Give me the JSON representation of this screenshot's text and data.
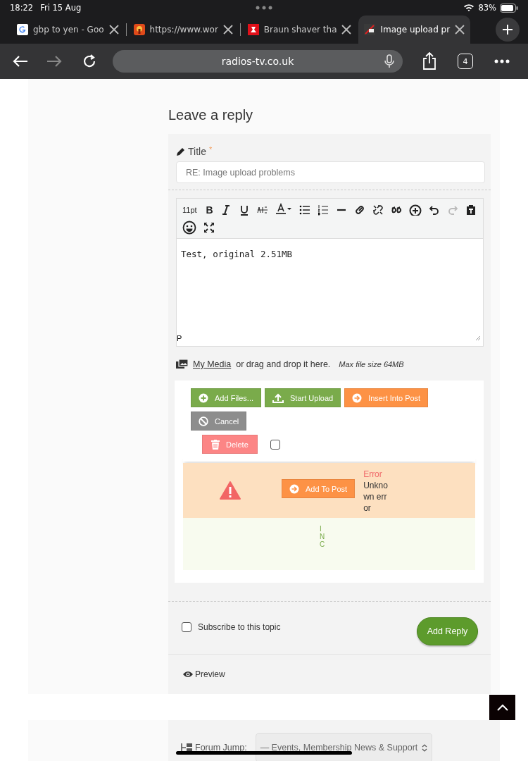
{
  "status_bar": {
    "time": "18:22",
    "date": "Fri 15 Aug",
    "battery": "83%"
  },
  "tabs": [
    {
      "title": "gbp to yen - Goo",
      "selected": false
    },
    {
      "title": "https://www.wor",
      "selected": false
    },
    {
      "title": "Braun shaver tha",
      "selected": false
    },
    {
      "title": "Image upload pr",
      "selected": true
    }
  ],
  "address_bar": {
    "url": "radios-tv.co.uk",
    "tab_count": "4"
  },
  "heading": "Leave a reply",
  "title_field": {
    "label": "Title",
    "required_mark": "*",
    "value": "RE: Image upload problems"
  },
  "editor": {
    "font_size": "11pt",
    "bold": "B",
    "text": "Test, original 2.51MB",
    "path": "P"
  },
  "media": {
    "link": "My Media",
    "hint": "or drag and drop it here.",
    "max_size": "Max file size 64MB"
  },
  "upload_buttons": [
    {
      "label": "Add Files...",
      "kind": "add"
    },
    {
      "label": "Start Upload",
      "kind": "upload"
    },
    {
      "label": "Insert Into Post",
      "kind": "insert"
    },
    {
      "label": "Cancel",
      "kind": "cancel"
    }
  ],
  "delete_button": "Delete",
  "select_all": {
    "checked": false
  },
  "files": [
    {
      "button": "Add To Post",
      "error_title": "Error",
      "error_text": "Unknown error"
    }
  ],
  "file_info": "INC",
  "subscribe": {
    "label": "Subscribe to this topic",
    "checked": false
  },
  "submit": "Add Reply",
  "preview": "Preview",
  "forum_jump": {
    "label": "Forum Jump:",
    "value": "— Events, Membership News & Support"
  }
}
